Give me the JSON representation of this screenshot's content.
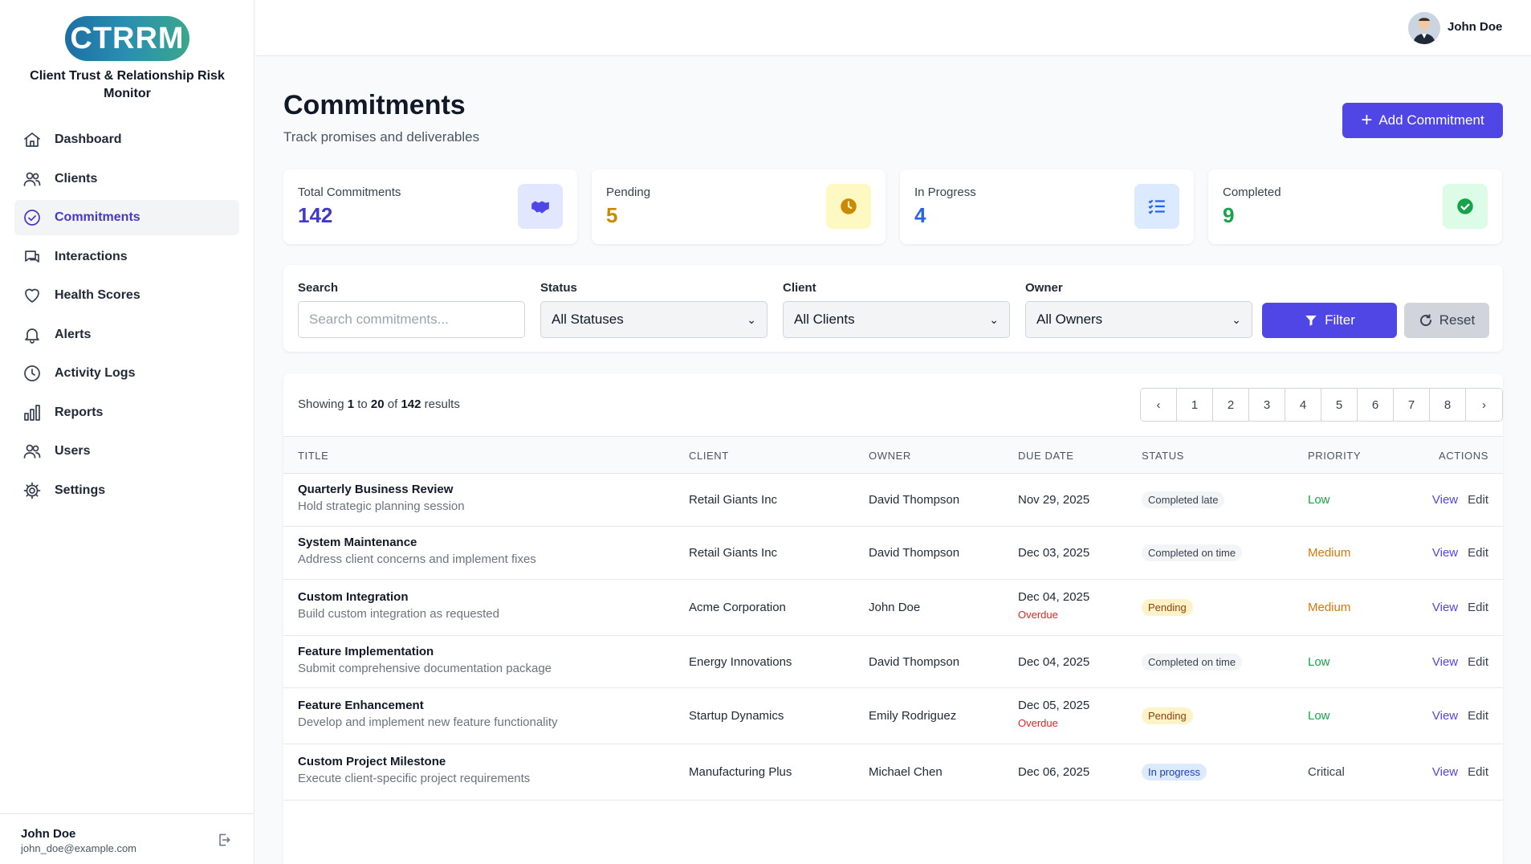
{
  "app": {
    "logo_text": "CTRRM",
    "subtitle": "Client Trust & Relationship Risk Monitor"
  },
  "sidebar": {
    "items": [
      {
        "label": "Dashboard",
        "icon": "home-icon",
        "active": false
      },
      {
        "label": "Clients",
        "icon": "users-icon",
        "active": false
      },
      {
        "label": "Commitments",
        "icon": "check-circle-icon",
        "active": true
      },
      {
        "label": "Interactions",
        "icon": "chat-icon",
        "active": false
      },
      {
        "label": "Health Scores",
        "icon": "heart-icon",
        "active": false
      },
      {
        "label": "Alerts",
        "icon": "bell-icon",
        "active": false
      },
      {
        "label": "Activity Logs",
        "icon": "clock-icon",
        "active": false
      },
      {
        "label": "Reports",
        "icon": "bar-chart-icon",
        "active": false
      },
      {
        "label": "Users",
        "icon": "users-icon",
        "active": false
      },
      {
        "label": "Settings",
        "icon": "gear-icon",
        "active": false
      }
    ],
    "user": {
      "name": "John Doe",
      "email": "john_doe@example.com"
    }
  },
  "header": {
    "user_name": "John Doe"
  },
  "page": {
    "title": "Commitments",
    "subtitle": "Track promises and deliverables",
    "add_button": "Add Commitment"
  },
  "stats": [
    {
      "label": "Total Commitments",
      "value": "142",
      "color": "#4338ca",
      "icon": "handshake-icon",
      "icon_bg": "#e0e7ff",
      "icon_color": "#4f46e5"
    },
    {
      "label": "Pending",
      "value": "5",
      "color": "#ca8a04",
      "icon": "clock-icon",
      "icon_bg": "#fef9c3",
      "icon_color": "#ca8a04"
    },
    {
      "label": "In Progress",
      "value": "4",
      "color": "#2563eb",
      "icon": "list-check-icon",
      "icon_bg": "#dbeafe",
      "icon_color": "#2563eb"
    },
    {
      "label": "Completed",
      "value": "9",
      "color": "#16a34a",
      "icon": "check-circle-icon",
      "icon_bg": "#dcfce7",
      "icon_color": "#16a34a"
    }
  ],
  "filters": {
    "search_label": "Search",
    "search_placeholder": "Search commitments...",
    "status_label": "Status",
    "status_value": "All Statuses",
    "client_label": "Client",
    "client_value": "All Clients",
    "owner_label": "Owner",
    "owner_value": "All Owners",
    "filter_button": "Filter",
    "reset_button": "Reset"
  },
  "table": {
    "showing": {
      "prefix": "Showing",
      "from": "1",
      "to_word": "to",
      "to": "20",
      "of_word": "of",
      "total": "142",
      "suffix": "results"
    },
    "pages": [
      "1",
      "2",
      "3",
      "4",
      "5",
      "6",
      "7",
      "8"
    ],
    "headers": {
      "title": "TITLE",
      "client": "CLIENT",
      "owner": "OWNER",
      "due": "DUE DATE",
      "status": "STATUS",
      "priority": "PRIORITY",
      "actions": "ACTIONS"
    },
    "view_label": "View",
    "edit_label": "Edit",
    "overdue_label": "Overdue",
    "rows": [
      {
        "title": "Quarterly Business Review",
        "desc": "Hold strategic planning session",
        "client": "Retail Giants Inc",
        "owner": "David Thompson",
        "due": "Nov 29, 2025",
        "overdue": false,
        "status": "Completed late",
        "status_style": "gray",
        "priority": "Low",
        "priority_style": "low"
      },
      {
        "title": "System Maintenance",
        "desc": "Address client concerns and implement fixes",
        "client": "Retail Giants Inc",
        "owner": "David Thompson",
        "due": "Dec 03, 2025",
        "overdue": false,
        "status": "Completed on time",
        "status_style": "gray",
        "priority": "Medium",
        "priority_style": "med"
      },
      {
        "title": "Custom Integration",
        "desc": "Build custom integration as requested",
        "client": "Acme Corporation",
        "owner": "John Doe",
        "due": "Dec 04, 2025",
        "overdue": true,
        "status": "Pending",
        "status_style": "yellow",
        "priority": "Medium",
        "priority_style": "med"
      },
      {
        "title": "Feature Implementation",
        "desc": "Submit comprehensive documentation package",
        "client": "Energy Innovations",
        "owner": "David Thompson",
        "due": "Dec 04, 2025",
        "overdue": false,
        "status": "Completed on time",
        "status_style": "gray",
        "priority": "Low",
        "priority_style": "low"
      },
      {
        "title": "Feature Enhancement",
        "desc": "Develop and implement new feature functionality",
        "client": "Startup Dynamics",
        "owner": "Emily Rodriguez",
        "due": "Dec 05, 2025",
        "overdue": true,
        "status": "Pending",
        "status_style": "yellow",
        "priority": "Low",
        "priority_style": "low"
      },
      {
        "title": "Custom Project Milestone",
        "desc": "Execute client-specific project requirements",
        "client": "Manufacturing Plus",
        "owner": "Michael Chen",
        "due": "Dec 06, 2025",
        "overdue": false,
        "status": "In progress",
        "status_style": "blue",
        "priority": "Critical",
        "priority_style": "crit"
      }
    ]
  }
}
